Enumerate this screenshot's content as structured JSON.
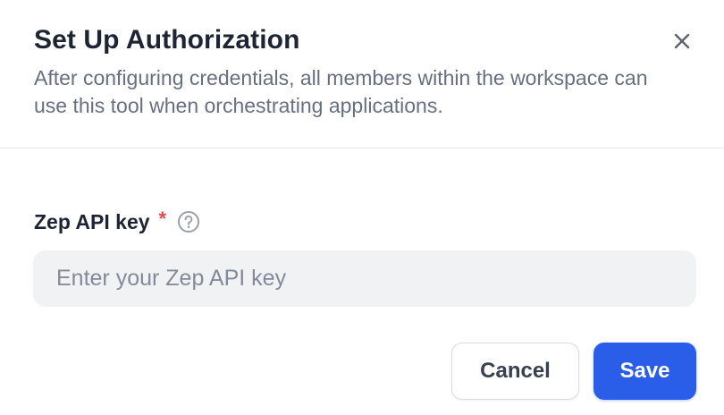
{
  "dialog": {
    "title": "Set Up Authorization",
    "subtitle": "After configuring credentials, all members within the workspace can use this tool when orchestrating applications.",
    "close_icon": "close-icon"
  },
  "form": {
    "field_label": "Zep API key",
    "required_mark": "*",
    "help_icon": "question-circle-icon",
    "input_placeholder": "Enter your Zep API key",
    "input_value": ""
  },
  "actions": {
    "cancel_label": "Cancel",
    "save_label": "Save"
  },
  "colors": {
    "primary": "#2a5ee8",
    "required": "#e5484d",
    "input_bg": "#f1f2f4",
    "title_text": "#1d2433",
    "muted_text": "#676f83"
  }
}
